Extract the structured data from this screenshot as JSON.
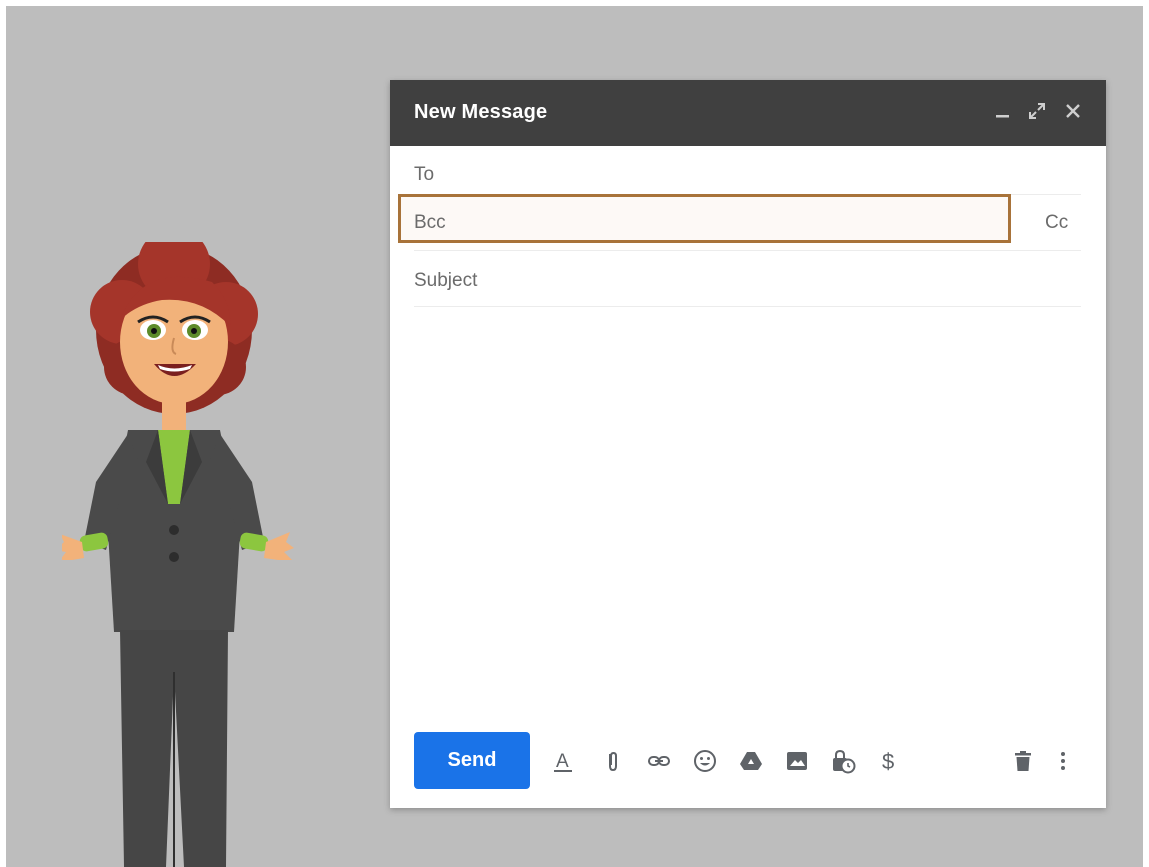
{
  "compose": {
    "title": "New Message",
    "window_controls": {
      "minimize_icon": "minimize-icon",
      "expand_icon": "expand-icon",
      "close_icon": "close-icon"
    },
    "to_label": "To",
    "bcc_label": "Bcc",
    "cc_link": "Cc",
    "subject_placeholder": "Subject",
    "highlight_color": "#a8733a"
  },
  "toolbar": {
    "send_label": "Send",
    "send_color": "#1a73e8",
    "icons": [
      "format-text-icon",
      "attach-icon",
      "link-icon",
      "emoji-icon",
      "drive-icon",
      "photo-icon",
      "confidential-mode-icon",
      "money-icon",
      "trash-icon",
      "more-options-icon"
    ]
  },
  "header_color": "#404040",
  "background_color": "#bdbdbd"
}
